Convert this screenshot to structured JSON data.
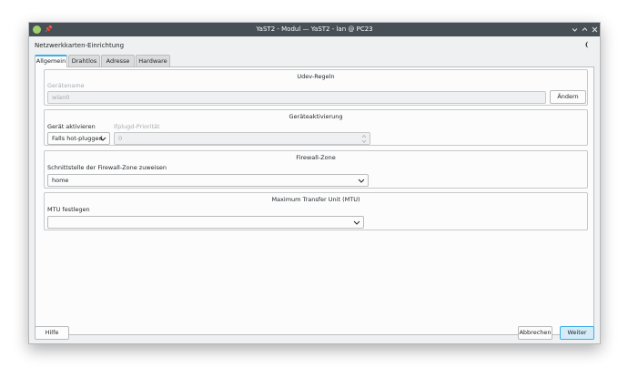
{
  "window": {
    "title": "YaST2 - Modul — YaST2 - lan @ PC23"
  },
  "dialog": {
    "title": "Netzwerkkarten-Einrichtung"
  },
  "tabs": [
    {
      "label": "Allgemein",
      "active": true
    },
    {
      "label": "Drahtlos",
      "active": false
    },
    {
      "label": "Adresse",
      "active": false
    },
    {
      "label": "Hardware",
      "active": false
    }
  ],
  "udev": {
    "title": "Udev-Regeln",
    "device_name_label": "Gerätename",
    "device_name_value": "wlan0",
    "change_button": "Ändern"
  },
  "activation": {
    "title": "Geräteaktivierung",
    "activate_label": "Gerät aktivieren",
    "activate_value": "Falls hot-plugged",
    "ifplugd_label": "ifplugd-Priorität",
    "ifplugd_value": "0"
  },
  "firewall": {
    "title": "Firewall-Zone",
    "assign_label": "Schnittstelle der Firewall-Zone zuweisen",
    "zone_value": "home"
  },
  "mtu": {
    "title": "Maximum Transfer Unit (MTU)",
    "set_label": "MTU festlegen",
    "value": ""
  },
  "buttons": {
    "help": "Hilfe",
    "cancel": "Abbrechen",
    "next": "Weiter"
  },
  "colors": {
    "titlebar": "#475057",
    "accent": "#3daee9",
    "window_bg": "#eff0f1"
  },
  "icons": {
    "app": "yast-app-icon",
    "pin": "pin-icon",
    "minimize": "chevron-down-icon",
    "maximize": "chevron-up-icon",
    "close": "close-icon",
    "theme": "moon-icon"
  }
}
